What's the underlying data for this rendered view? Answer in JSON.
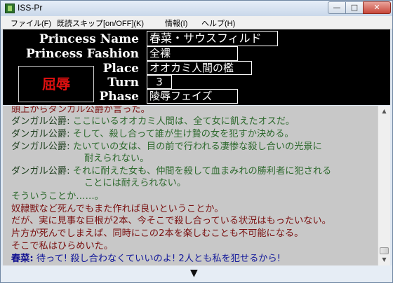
{
  "window": {
    "title": "ISS-Pr",
    "min_label": "—",
    "max_label": "□",
    "close_label": "✕"
  },
  "menu": {
    "items": [
      "ファイル(F)",
      "既読スキップ[on/OFF](K)",
      "情報(I)",
      "ヘルプ(H)"
    ]
  },
  "header": {
    "labels": {
      "name": "Princess Name",
      "fashion": "Princess Fashion",
      "place": "Place",
      "turn": "Turn",
      "phase": "Phase"
    },
    "values": {
      "name": "春菜・サウスフィルド",
      "fashion": "全裸",
      "place": "オオカミ人間の檻",
      "turn": "3",
      "phase": "陵辱フェイズ"
    },
    "status": "屈辱",
    "colors": {
      "status": "#e01010",
      "panel": "#000000"
    }
  },
  "dialogue": {
    "lines": [
      {
        "speaker": "",
        "text": "頭上からダンガル公爵が言った。"
      },
      {
        "speaker": "ダンガル公爵:",
        "text": "ここにいるオオカミ人間は、全て女に飢えたオスだ。"
      },
      {
        "speaker": "ダンガル公爵:",
        "text": "そして、殺し合って誰が生け贄の女を犯すか決める。"
      },
      {
        "speaker": "ダンガル公爵:",
        "text": "たいていの女は、目の前で行われる凄惨な殺し合いの光景に"
      },
      {
        "speaker": "",
        "text": "耐えられない。"
      },
      {
        "speaker": "ダンガル公爵:",
        "text": "それに耐えた女も、仲間を殺して血まみれの勝利者に犯される"
      },
      {
        "speaker": "",
        "text": "ことには耐えられない。"
      },
      {
        "speaker": "",
        "text": "そういうことか……。"
      },
      {
        "speaker": "",
        "text": "奴隷獣など死んでもまた作れば良いということか。"
      },
      {
        "speaker": "",
        "text": "だが、実に見事な巨根が2本、今そこで殺し合っている状況はもったいない。"
      },
      {
        "speaker": "",
        "text": "片方が死んでしまえば、同時にこの2本を楽しむことも不可能になる。"
      },
      {
        "speaker": "",
        "text": "そこで私はひらめいた。"
      },
      {
        "speaker": "春菜:",
        "text": "待って!  殺し合わなくていいのよ!  2人とも私を犯せるから!"
      }
    ]
  },
  "scroll": {
    "up": "▲",
    "down": "▼"
  },
  "footer": {
    "next": "▼"
  }
}
